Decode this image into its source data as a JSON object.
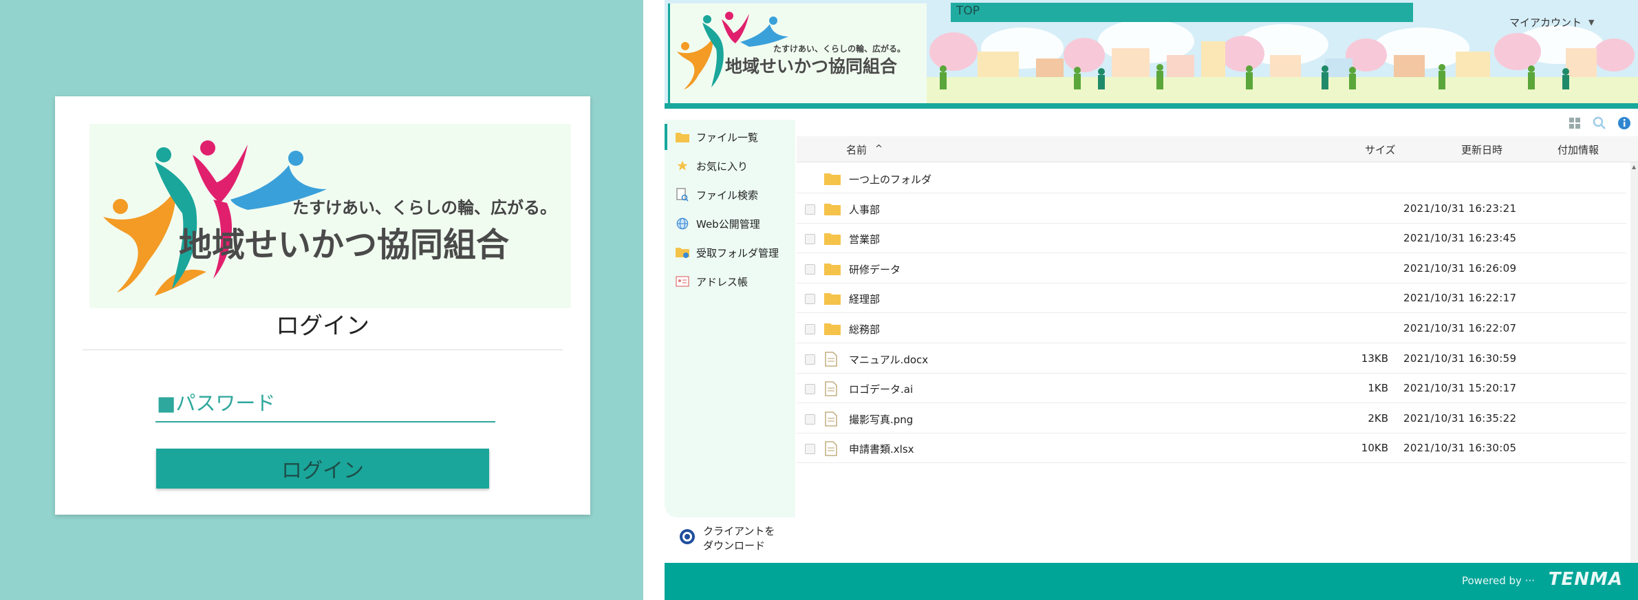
{
  "login": {
    "logo": {
      "tagline": "たすけあい、くらしの輪、広がる。",
      "org_name": "地域せいかつ協同組合"
    },
    "title": "ログイン",
    "password_placeholder": "■パスワード",
    "button_label": "ログイン"
  },
  "header": {
    "logo": {
      "tagline": "たすけあい、くらしの輪、広がる。",
      "org_name": "地域せいかつ協同組合"
    },
    "top_label": "TOP",
    "account_label": "マイアカウント"
  },
  "sidebar": {
    "items": [
      {
        "label": "ファイル一覧",
        "icon": "folder-icon",
        "active": true
      },
      {
        "label": "お気に入り",
        "icon": "star-icon",
        "active": false
      },
      {
        "label": "ファイル検索",
        "icon": "file-search-icon",
        "active": false
      },
      {
        "label": "Web公開管理",
        "icon": "globe-icon",
        "active": false
      },
      {
        "label": "受取フォルダ管理",
        "icon": "receive-folder-icon",
        "active": false
      },
      {
        "label": "アドレス帳",
        "icon": "address-book-icon",
        "active": false
      }
    ],
    "client_download": {
      "line1": "クライアントを",
      "line2": "ダウンロード"
    }
  },
  "toolbar": {
    "icons": [
      "grid-view-icon",
      "search-icon",
      "info-icon"
    ]
  },
  "table": {
    "columns": {
      "name": "名前",
      "sort_indicator": "^",
      "size": "サイズ",
      "updated": "更新日時",
      "info": "付加情報"
    },
    "rows": [
      {
        "type": "parent",
        "name": "一つ上のフォルダ",
        "size": "",
        "updated": ""
      },
      {
        "type": "folder",
        "name": "人事部",
        "size": "",
        "updated": "2021/10/31 16:23:21"
      },
      {
        "type": "folder",
        "name": "営業部",
        "size": "",
        "updated": "2021/10/31 16:23:45"
      },
      {
        "type": "folder",
        "name": "研修データ",
        "size": "",
        "updated": "2021/10/31 16:26:09"
      },
      {
        "type": "folder",
        "name": "経理部",
        "size": "",
        "updated": "2021/10/31 16:22:17"
      },
      {
        "type": "folder",
        "name": "総務部",
        "size": "",
        "updated": "2021/10/31 16:22:07"
      },
      {
        "type": "file",
        "name": "マニュアル.docx",
        "size": "13KB",
        "updated": "2021/10/31 16:30:59"
      },
      {
        "type": "file",
        "name": "ロゴデータ.ai",
        "size": "1KB",
        "updated": "2021/10/31 15:20:17"
      },
      {
        "type": "file",
        "name": "撮影写真.png",
        "size": "2KB",
        "updated": "2021/10/31 16:35:22"
      },
      {
        "type": "file",
        "name": "申請書類.xlsx",
        "size": "10KB",
        "updated": "2021/10/31 16:30:05"
      }
    ]
  },
  "footer": {
    "powered_by": "Powered by ···",
    "brand": "TENMA"
  },
  "colors": {
    "accent": "#17a89c",
    "login_bg": "#93d3cd",
    "folder": "#f5c34a",
    "sidebar_bg": "#eefbf5"
  }
}
